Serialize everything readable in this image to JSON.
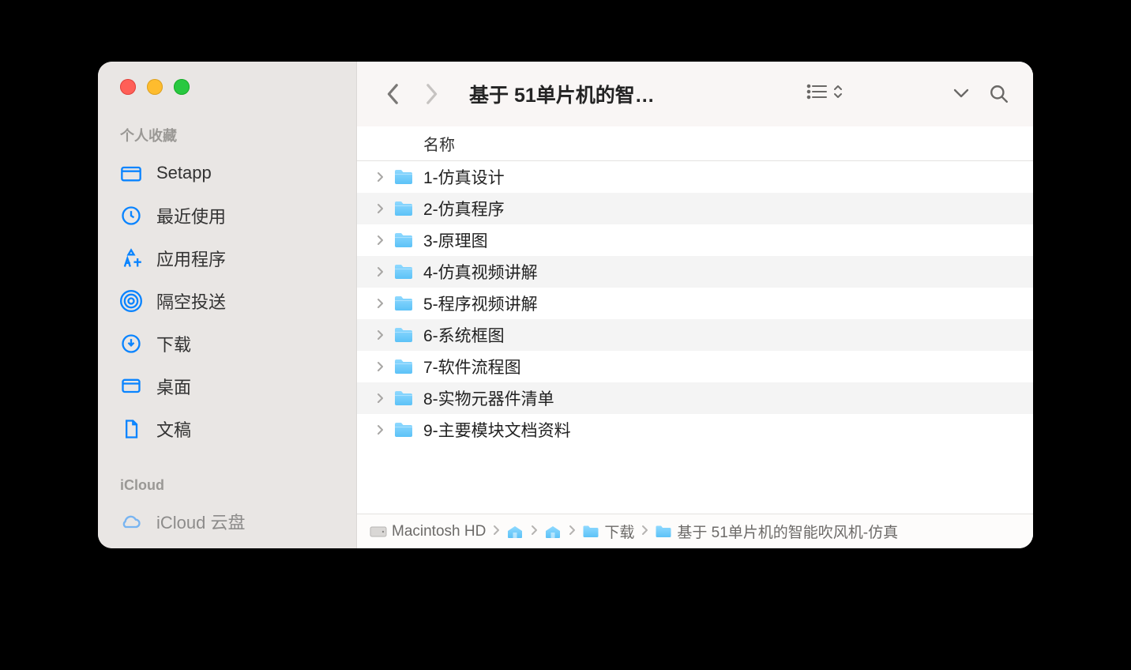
{
  "window": {
    "title": "基于 51单片机的智…"
  },
  "sidebar": {
    "sections": [
      {
        "label": "个人收藏",
        "items": [
          {
            "icon": "folder",
            "label": "Setapp"
          },
          {
            "icon": "clock",
            "label": "最近使用"
          },
          {
            "icon": "apps",
            "label": "应用程序"
          },
          {
            "icon": "airdrop",
            "label": "隔空投送"
          },
          {
            "icon": "download",
            "label": "下载"
          },
          {
            "icon": "desktop",
            "label": "桌面"
          },
          {
            "icon": "doc",
            "label": "文稿"
          }
        ]
      },
      {
        "label": "iCloud",
        "items": [
          {
            "icon": "cloud",
            "label": "iCloud 云盘"
          }
        ]
      }
    ]
  },
  "columns": {
    "name": "名称"
  },
  "files": [
    {
      "name": "1-仿真设计"
    },
    {
      "name": "2-仿真程序"
    },
    {
      "name": "3-原理图"
    },
    {
      "name": "4-仿真视频讲解"
    },
    {
      "name": "5-程序视频讲解"
    },
    {
      "name": "6-系统框图"
    },
    {
      "name": "7-软件流程图"
    },
    {
      "name": "8-实物元器件清单"
    },
    {
      "name": "9-主要模块文档资料"
    }
  ],
  "path": [
    {
      "icon": "hdd",
      "label": "Macintosh HD"
    },
    {
      "icon": "home",
      "label": ""
    },
    {
      "icon": "home",
      "label": ""
    },
    {
      "icon": "folder",
      "label": "下载"
    },
    {
      "icon": "folder",
      "label": "基于 51单片机的智能吹风机-仿真"
    }
  ]
}
